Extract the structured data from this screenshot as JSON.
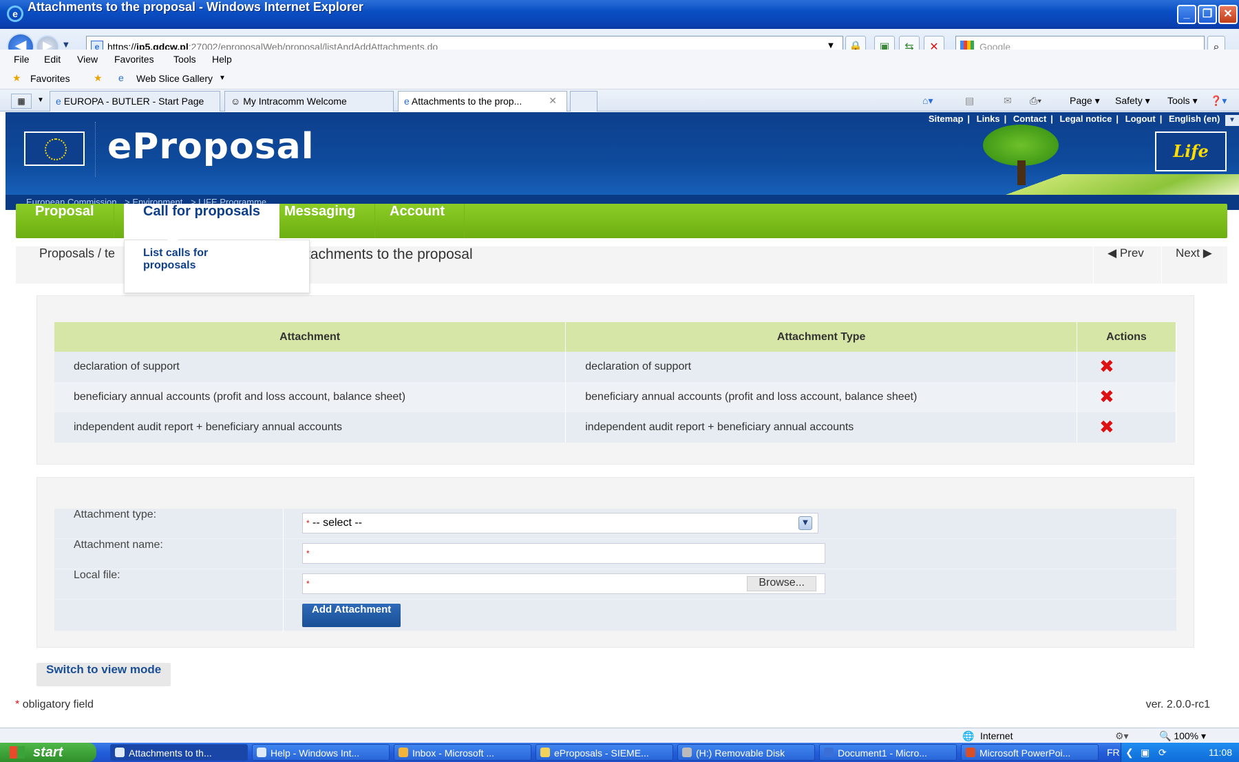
{
  "window": {
    "title": "Attachments to the proposal - Windows Internet Explorer"
  },
  "browser": {
    "address_https": "https://",
    "address_host": "ip5.gdcw.pl",
    "address_path": ":27002/eproposalWeb/proposal/listAndAddAttachments.do",
    "search_placeholder": "Google",
    "menu": [
      "File",
      "Edit",
      "View",
      "Favorites",
      "Tools",
      "Help"
    ],
    "favorites_label": "Favorites",
    "web_slice_label": "Web Slice Gallery",
    "tabs": [
      {
        "label": "EUROPA - BUTLER - Start Page"
      },
      {
        "label": "My Intracomm Welcome"
      },
      {
        "label": "Attachments to the prop..."
      }
    ],
    "commands": [
      "Page",
      "Safety",
      "Tools"
    ]
  },
  "site": {
    "brand": "eProposal",
    "top_links": [
      "Sitemap",
      "Links",
      "Contact",
      "Legal notice",
      "Logout",
      "English (en)"
    ],
    "breadcrumb": [
      "European Commission",
      "> Environment",
      "> LIFE Programme"
    ],
    "life_logo": "Life",
    "nav": [
      "Proposal",
      "Call for proposals",
      "Messaging",
      "Account"
    ],
    "dropdown_item": "List calls for proposals",
    "page_crumb": "Proposals / te",
    "page_title": "tachments to the proposal",
    "prev": "Prev",
    "next": "Next"
  },
  "attachments": {
    "headers": [
      "Attachment",
      "Attachment Type",
      "Actions"
    ],
    "rows": [
      {
        "name": "declaration of support",
        "type": "declaration of support"
      },
      {
        "name": "beneficiary annual accounts (profit and loss account, balance sheet)",
        "type": "beneficiary annual accounts (profit and loss account, balance sheet)"
      },
      {
        "name": "independent audit report + beneficiary annual accounts",
        "type": "independent audit report + beneficiary annual accounts"
      }
    ]
  },
  "form": {
    "type_label": "Attachment type:",
    "type_value": "-- select --",
    "name_label": "Attachment name:",
    "file_label": "Local file:",
    "browse": "Browse...",
    "add": "Add Attachment",
    "required_mark": "*"
  },
  "footer": {
    "switch": "Switch to view mode",
    "obligatory": "obligatory field",
    "version": "ver. 2.0.0-rc1"
  },
  "statusbar": {
    "zone": "Internet",
    "zoom": "100%"
  },
  "taskbar": {
    "start": "start",
    "tasks": [
      "Attachments to th...",
      "Help - Windows Int...",
      "Inbox - Microsoft ...",
      "eProposals - SIEME...",
      "(H:) Removable Disk",
      "Document1 - Micro...",
      "Microsoft PowerPoi..."
    ],
    "lang": "FR",
    "clock": "11:08"
  }
}
